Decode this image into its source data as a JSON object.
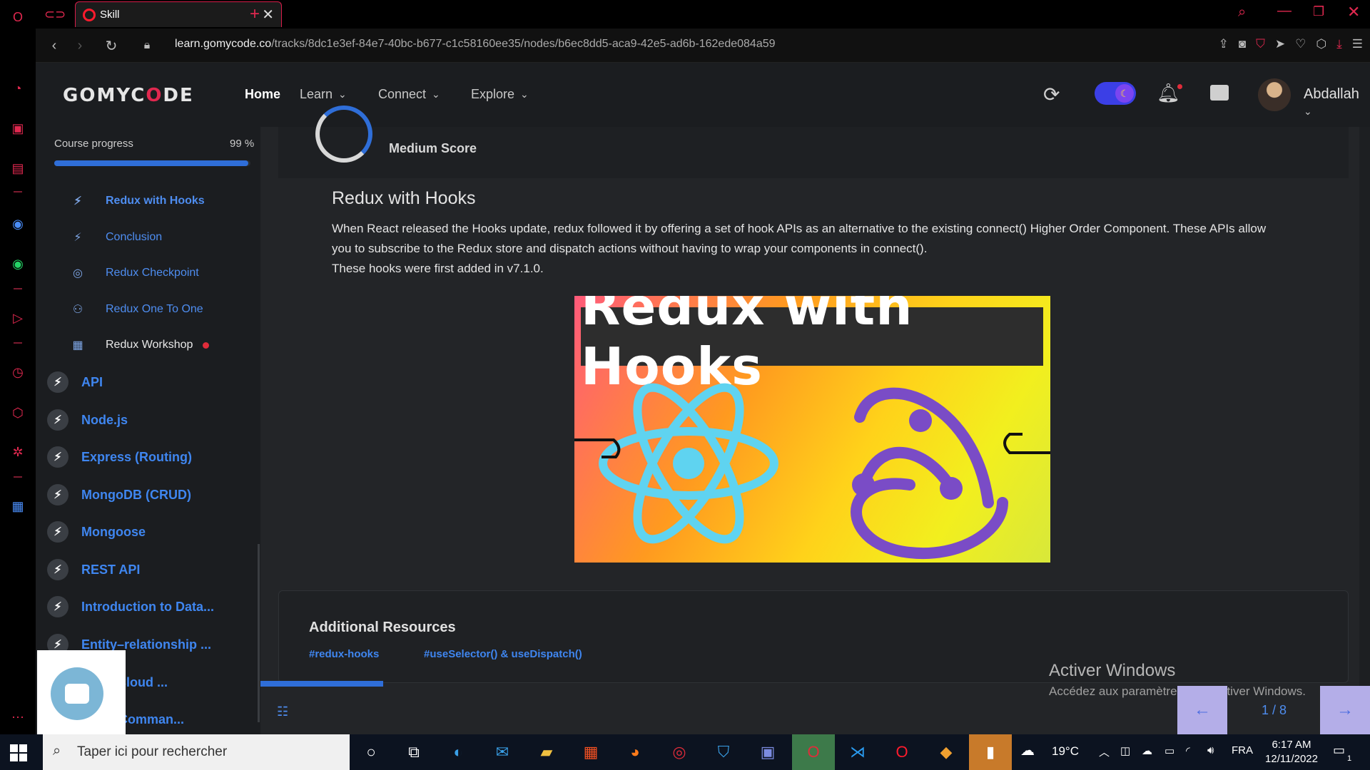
{
  "browser": {
    "tab_title": "Skill",
    "url_domain": "learn.gomycode.co",
    "url_path": "/tracks/8dc1e3ef-84e7-40bc-b677-c1c58160ee35/nodes/b6ec8dd5-aca9-42e5-ad6b-162ede084a59",
    "accent_color": "#e0284f"
  },
  "header": {
    "logo_left": "GOMYC",
    "logo_accent": "O",
    "logo_right": "DE",
    "nav": {
      "home": "Home",
      "learn": "Learn",
      "connect": "Connect",
      "explore": "Explore"
    },
    "username": "Abdallah"
  },
  "sidebar": {
    "progress_label": "Course progress",
    "progress_value": "99 %",
    "progress_fraction": 0.99,
    "sub_items": [
      {
        "label": "Redux with Hooks",
        "icon": "bolt-icon"
      },
      {
        "label": "Conclusion",
        "icon": "bolt-icon"
      },
      {
        "label": "Redux Checkpoint",
        "icon": "target-icon"
      },
      {
        "label": "Redux One To One",
        "icon": "people-icon"
      },
      {
        "label": "Redux Workshop",
        "icon": "workshop-icon"
      }
    ],
    "modules": [
      "API",
      "Node.js",
      "Express (Routing)",
      "MongoDB (CRUD)",
      "Mongoose",
      "REST API",
      "Introduction to Data...",
      "Entity–relationship ...",
      "ion & Cloud ...",
      "Flow (Comman..."
    ]
  },
  "main": {
    "score_text": "Medium Score",
    "lesson_title": "Redux with Hooks",
    "body_line1": "When React released the Hooks update, redux followed it by offering a set of hook APIs as an alternative to the existing connect() Higher Order Component. These APIs allow",
    "body_line2": "you to subscribe to the Redux store and dispatch actions without having to wrap your components in connect().",
    "body_line3": "These hooks were first added in v7.1.0.",
    "hero_title": "Redux with Hooks",
    "resources_title": "Additional Resources",
    "resources_tags": [
      "#redux-hooks",
      "#useSelector() & useDispatch()"
    ],
    "pager": "1 / 8"
  },
  "overlay": {
    "activate_title": "Activer Windows",
    "activate_sub": "Accédez aux paramètres pour activer Windows."
  },
  "taskbar": {
    "search_placeholder": "Taper ici pour rechercher",
    "weather": "19°C",
    "language": "FRA",
    "time": "6:17 AM",
    "date": "12/11/2022",
    "notification_count": "1"
  }
}
